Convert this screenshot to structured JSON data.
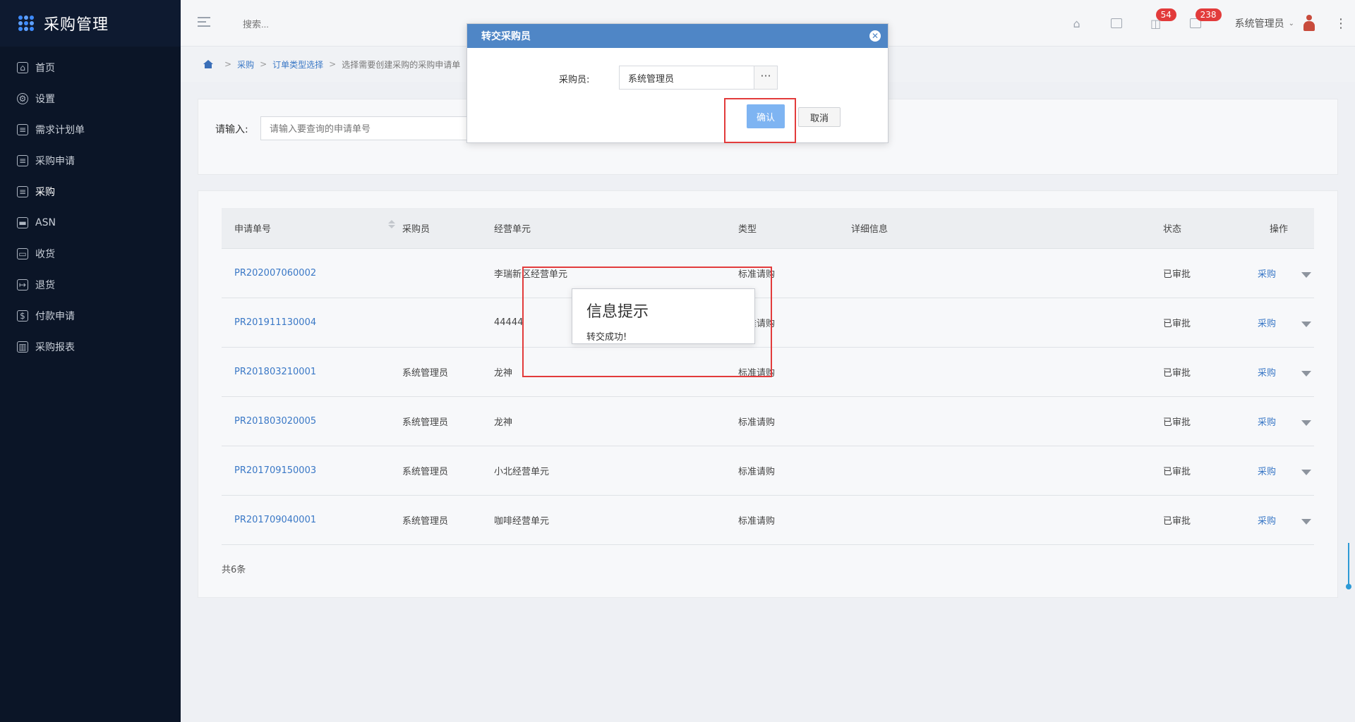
{
  "app": {
    "title": "采购管理"
  },
  "sidebar": {
    "items": [
      {
        "label": "首页",
        "icon": "home-icon"
      },
      {
        "label": "设置",
        "icon": "gear-icon"
      },
      {
        "label": "需求计划单",
        "icon": "document-icon"
      },
      {
        "label": "采购申请",
        "icon": "form-icon"
      },
      {
        "label": "采购",
        "icon": "cart-list-icon"
      },
      {
        "label": "ASN",
        "icon": "truck-icon"
      },
      {
        "label": "收货",
        "icon": "inbox-icon"
      },
      {
        "label": "退货",
        "icon": "return-icon"
      },
      {
        "label": "付款申请",
        "icon": "payment-icon"
      },
      {
        "label": "采购报表",
        "icon": "bar-chart-icon"
      }
    ]
  },
  "topbar": {
    "search_placeholder": "搜索...",
    "badges": {
      "notifications": "54",
      "messages": "238"
    },
    "user_name": "系统管理员"
  },
  "breadcrumb": {
    "items": [
      "采购",
      "订单类型选择",
      "选择需要创建采购的采购申请单"
    ]
  },
  "filter": {
    "label": "请输入:",
    "placeholder": "请输入要查询的申请单号"
  },
  "table": {
    "headers": [
      "申请单号",
      "采购员",
      "经营单元",
      "类型",
      "详细信息",
      "状态",
      "操作"
    ],
    "rows": [
      {
        "no": "PR202007060002",
        "buyer": "",
        "unit": "李瑞新区经营单元",
        "type": "标准请购",
        "detail": "",
        "status": "已审批",
        "action": "采购"
      },
      {
        "no": "PR201911130004",
        "buyer": "",
        "unit": "44444",
        "type": "标准请购",
        "detail": "",
        "status": "已审批",
        "action": "采购"
      },
      {
        "no": "PR201803210001",
        "buyer": "系统管理员",
        "unit": "龙神",
        "type": "标准请购",
        "detail": "",
        "status": "已审批",
        "action": "采购"
      },
      {
        "no": "PR201803020005",
        "buyer": "系统管理员",
        "unit": "龙神",
        "type": "标准请购",
        "detail": "",
        "status": "已审批",
        "action": "采购"
      },
      {
        "no": "PR201709150003",
        "buyer": "系统管理员",
        "unit": "小北经营单元",
        "type": "标准请购",
        "detail": "",
        "status": "已审批",
        "action": "采购"
      },
      {
        "no": "PR201709040001",
        "buyer": "系统管理员",
        "unit": "咖啡经营单元",
        "type": "标准请购",
        "detail": "",
        "status": "已审批",
        "action": "采购"
      }
    ],
    "total": "共6条"
  },
  "dialog": {
    "title": "转交采购员",
    "field_label": "采购员:",
    "field_value": "系统管理员",
    "more_label": "···",
    "confirm_label": "确认",
    "cancel_label": "取消"
  },
  "toast": {
    "title": "信息提示",
    "message": "转交成功!"
  },
  "colors": {
    "sidebar_bg": "#0b1527",
    "dialog_header": "#4f86c6",
    "link": "#3a78c6",
    "highlight": "#e23b3b"
  }
}
